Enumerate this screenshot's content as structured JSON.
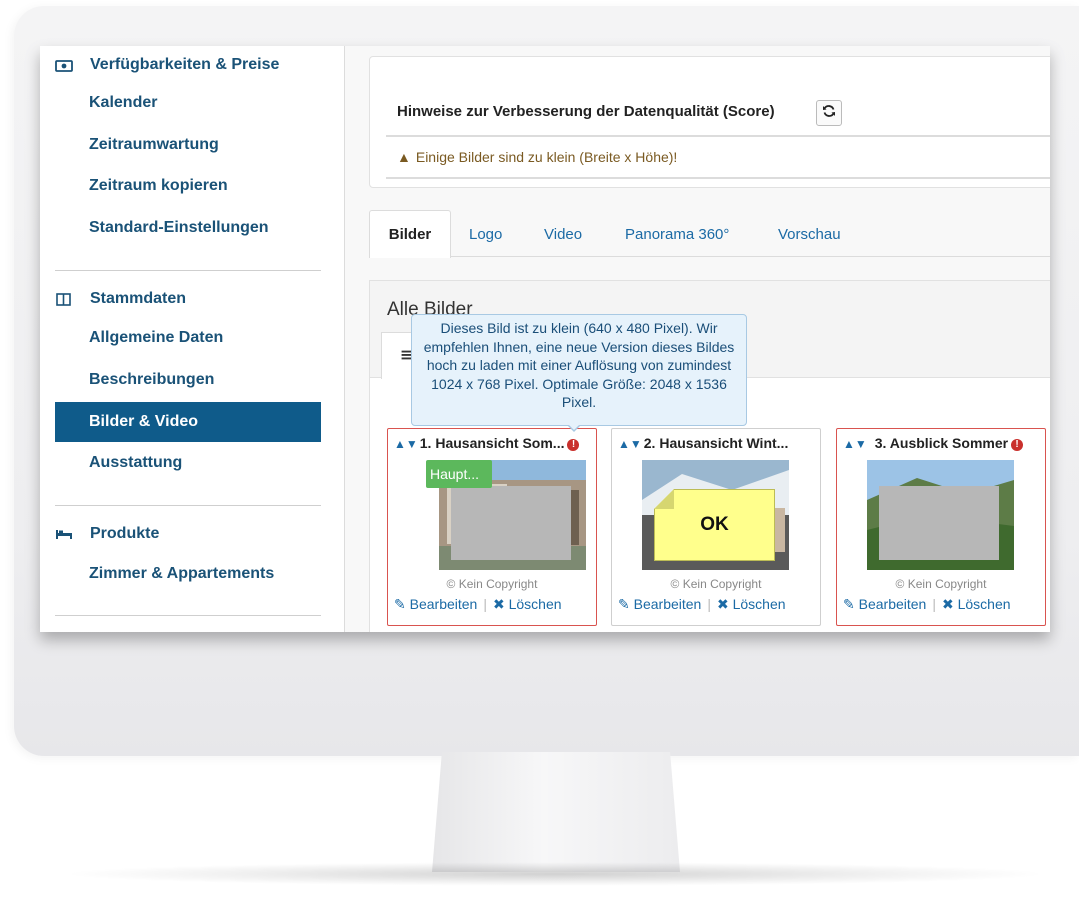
{
  "sidebar": {
    "sections": [
      {
        "title": "Verfügbarkeiten & Preise",
        "icon": "money-icon",
        "items": [
          "Kalender",
          "Zeitraumwartung",
          "Zeitraum kopieren",
          "Standard-Einstellungen"
        ]
      },
      {
        "title": "Stammdaten",
        "icon": "columns-icon",
        "items": [
          "Allgemeine Daten",
          "Beschreibungen",
          "Bilder & Video",
          "Ausstattung"
        ]
      },
      {
        "title": "Produkte",
        "icon": "bed-icon",
        "items": [
          "Zimmer & Appartements"
        ]
      }
    ],
    "active_item": "Bilder & Video"
  },
  "score": {
    "title": "Hinweise zur Verbesserung der Datenqualität (Score)",
    "refresh_icon": "refresh-icon",
    "warning": "Einige Bilder sind zu klein (Breite x Höhe)!",
    "warning_glyph": "▲"
  },
  "tabs": [
    "Bilder",
    "Logo",
    "Video",
    "Panorama 360°",
    "Vorschau"
  ],
  "gallery": {
    "title": "Alle Bilder",
    "subtab_glyph": "≡",
    "tooltip": "Dieses Bild ist zu klein (640 x 480 Pixel). Wir empfehlen Ihnen, eine neue Version dieses Bildes hoch zu laden mit einer Auflösung von zumindest 1024 x 768 Pixel. Optimale Größe: 2048 x 1536 Pixel.",
    "cards": [
      {
        "title": "1. Hausansicht Som...",
        "error": true,
        "badge": "Haupt...",
        "copyright": "© Kein Copyright",
        "edit": "Bearbeiten",
        "delete": "Löschen"
      },
      {
        "title": "2. Hausansicht Wint...",
        "error": false,
        "note": "OK",
        "copyright": "© Kein Copyright",
        "edit": "Bearbeiten",
        "delete": "Löschen"
      },
      {
        "title": "3. Ausblick Sommer",
        "error": true,
        "copyright": "© Kein Copyright",
        "edit": "Bearbeiten",
        "delete": "Löschen"
      }
    ]
  },
  "colors": {
    "sidebar_text": "#1a5277",
    "active_bg": "#0f5b8a",
    "link": "#1b6aa5",
    "error": "#d9534f",
    "badge": "#5cb85c",
    "note": "#ffff8c"
  }
}
